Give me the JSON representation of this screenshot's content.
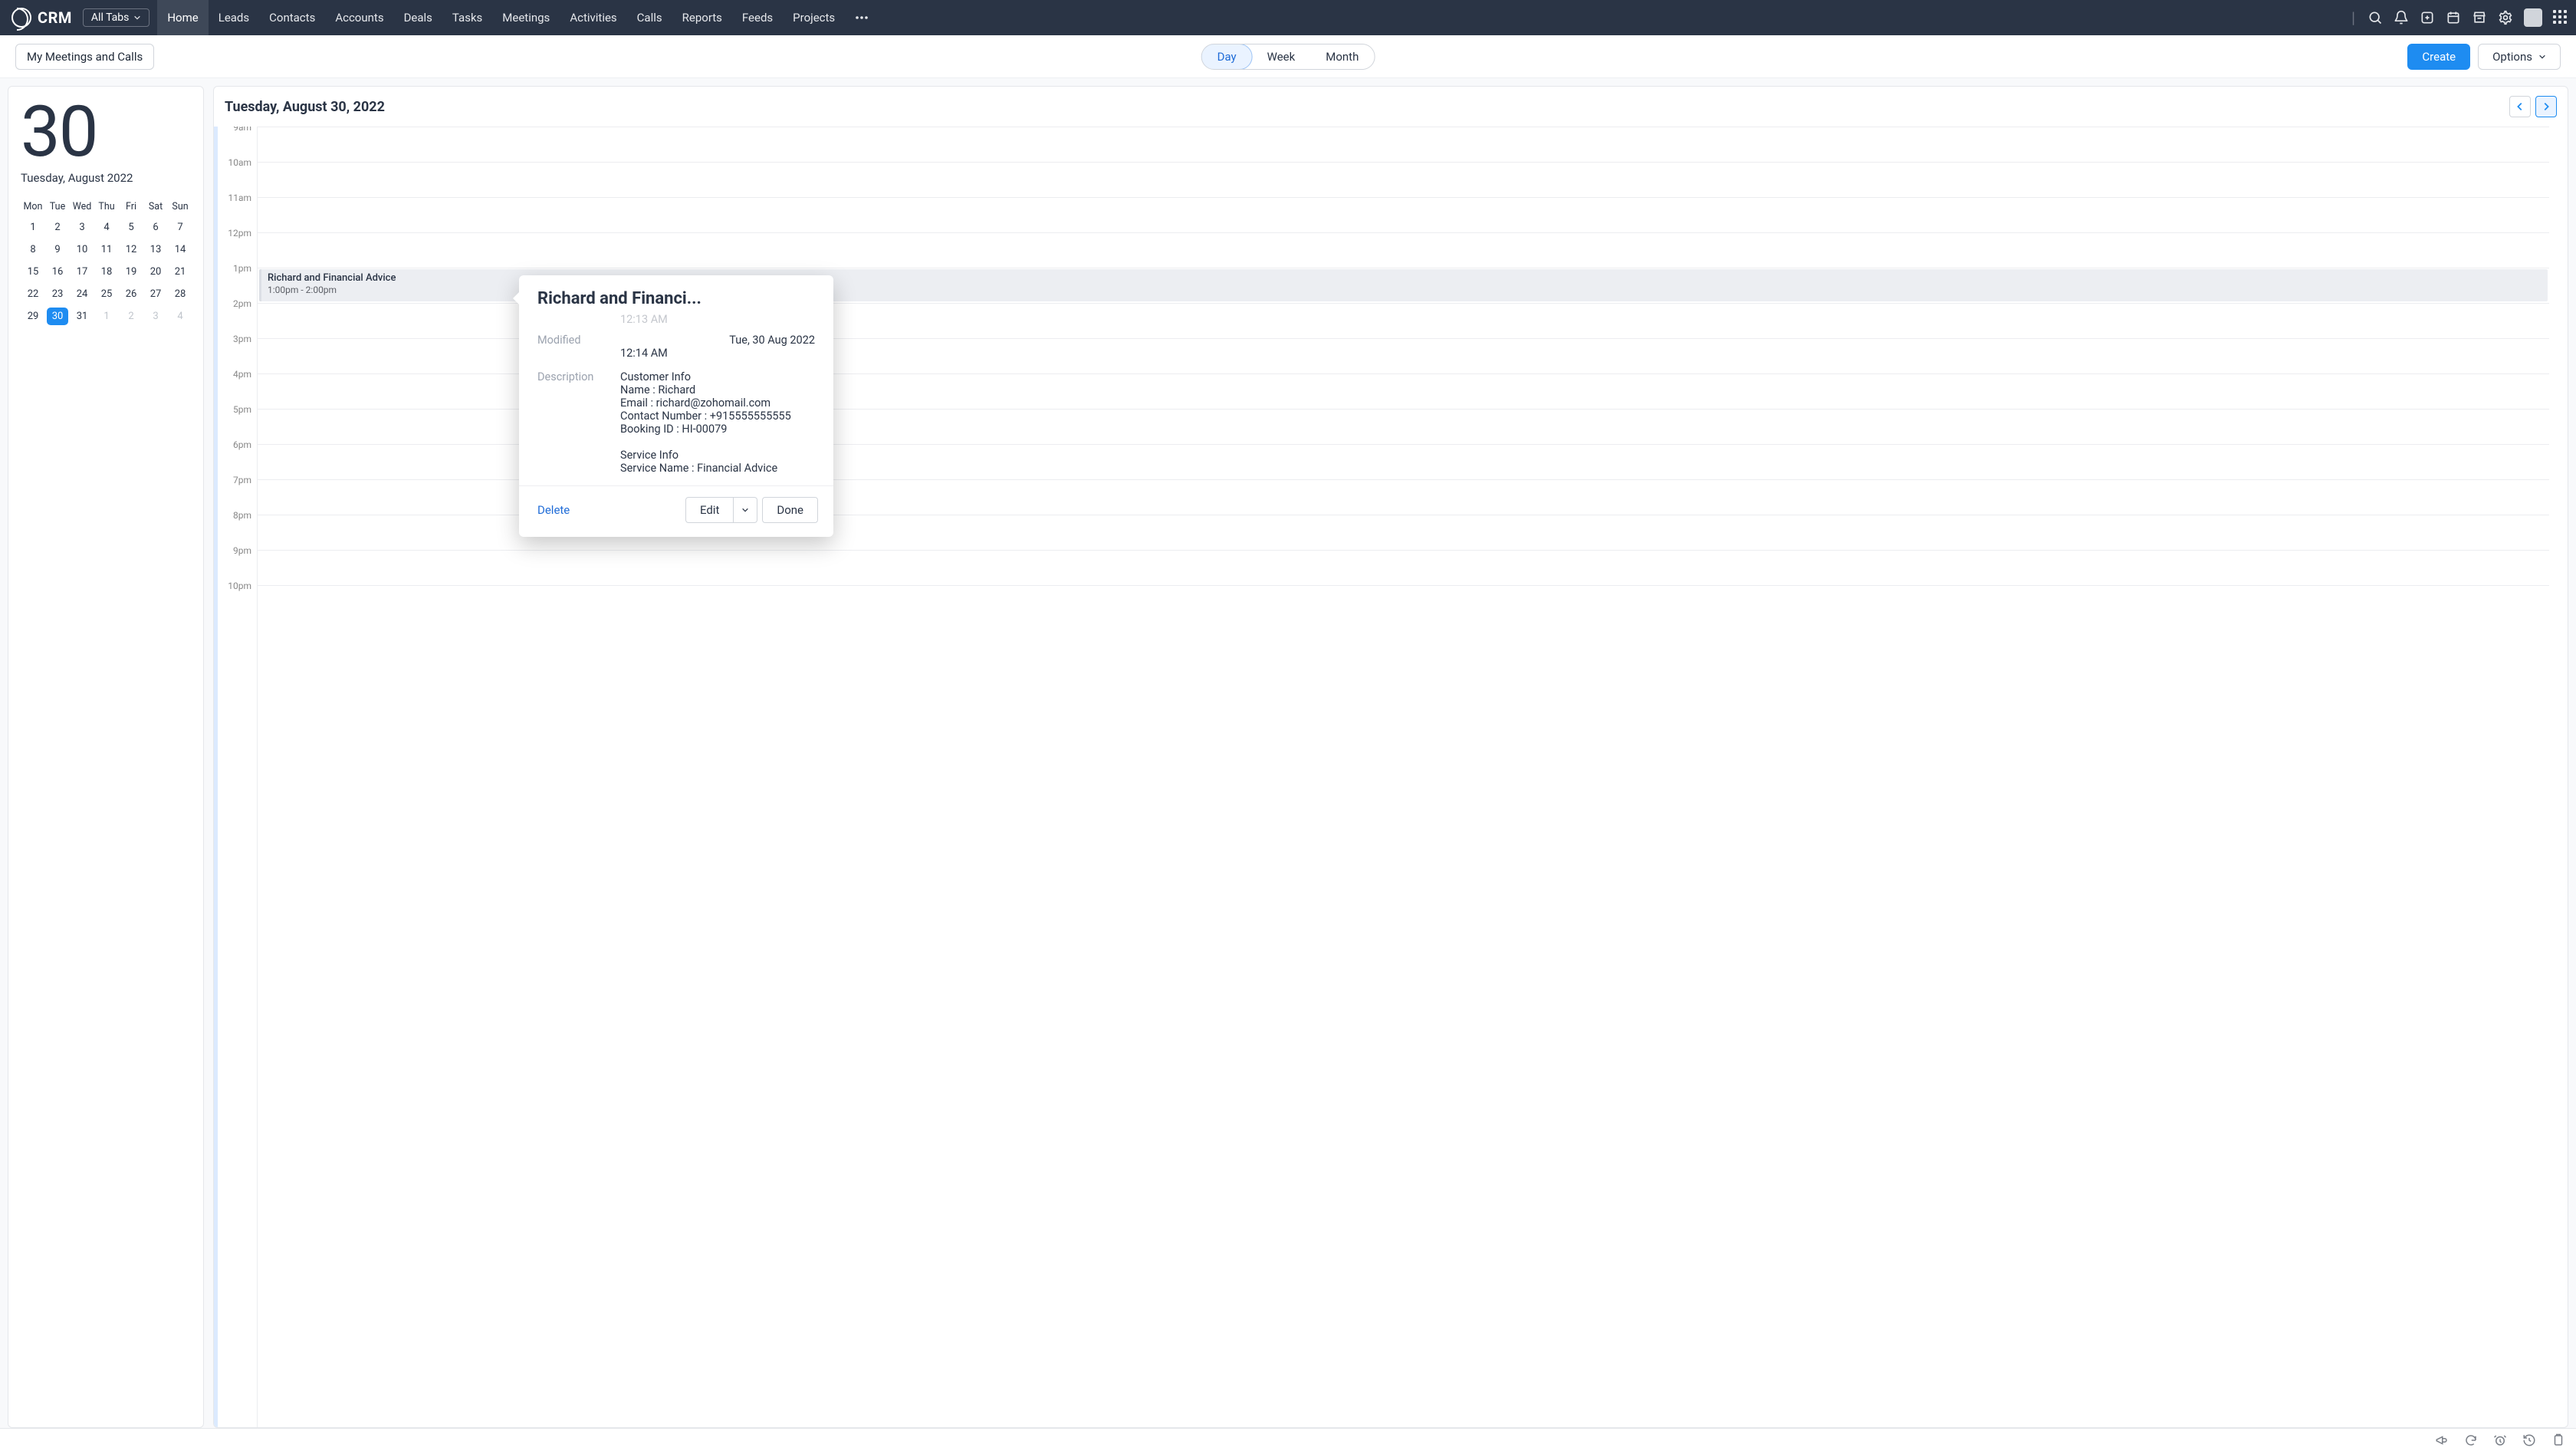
{
  "brand": "CRM",
  "tabs_selector_label": "All Tabs",
  "nav": [
    "Home",
    "Leads",
    "Contacts",
    "Accounts",
    "Deals",
    "Tasks",
    "Meetings",
    "Activities",
    "Calls",
    "Reports",
    "Feeds",
    "Projects"
  ],
  "nav_active": "Home",
  "subbar": {
    "view_name": "My Meetings and Calls",
    "views": [
      "Day",
      "Week",
      "Month"
    ],
    "active_view": "Day",
    "create_label": "Create",
    "options_label": "Options"
  },
  "sidebar": {
    "big_day": "30",
    "full_date": "Tuesday, August 2022",
    "dow": [
      "Mon",
      "Tue",
      "Wed",
      "Thu",
      "Fri",
      "Sat",
      "Sun"
    ],
    "weeks": [
      [
        {
          "n": "1"
        },
        {
          "n": "2"
        },
        {
          "n": "3"
        },
        {
          "n": "4"
        },
        {
          "n": "5"
        },
        {
          "n": "6"
        },
        {
          "n": "7"
        }
      ],
      [
        {
          "n": "8"
        },
        {
          "n": "9"
        },
        {
          "n": "10"
        },
        {
          "n": "11"
        },
        {
          "n": "12"
        },
        {
          "n": "13"
        },
        {
          "n": "14"
        }
      ],
      [
        {
          "n": "15"
        },
        {
          "n": "16"
        },
        {
          "n": "17"
        },
        {
          "n": "18"
        },
        {
          "n": "19"
        },
        {
          "n": "20"
        },
        {
          "n": "21"
        }
      ],
      [
        {
          "n": "22"
        },
        {
          "n": "23"
        },
        {
          "n": "24"
        },
        {
          "n": "25"
        },
        {
          "n": "26"
        },
        {
          "n": "27"
        },
        {
          "n": "28"
        }
      ],
      [
        {
          "n": "29"
        },
        {
          "n": "30",
          "sel": true
        },
        {
          "n": "31"
        },
        {
          "n": "1",
          "m": true
        },
        {
          "n": "2",
          "m": true
        },
        {
          "n": "3",
          "m": true
        },
        {
          "n": "4",
          "m": true
        }
      ]
    ]
  },
  "calendar": {
    "title": "Tuesday, August 30, 2022",
    "hours": [
      "9am",
      "10am",
      "11am",
      "12pm",
      "1pm",
      "2pm",
      "3pm",
      "4pm",
      "5pm",
      "6pm",
      "7pm",
      "8pm",
      "9pm",
      "10pm"
    ],
    "event": {
      "title": "Richard and Financial Advice",
      "time": "1:00pm - 2:00pm"
    }
  },
  "popover": {
    "title": "Richard and Financi...",
    "prev_time": "12:13 AM",
    "modified_label": "Modified",
    "modified_value": "Tue, 30 Aug 2022",
    "modified_time": "12:14 AM",
    "description_label": "Description",
    "description_body": "Customer Info\nName : Richard\nEmail : richard@zohomail.com\nContact Number : +915555555555\nBooking ID : HI-00079\n\nService Info\nService Name : Financial Advice",
    "delete_label": "Delete",
    "edit_label": "Edit",
    "done_label": "Done"
  }
}
